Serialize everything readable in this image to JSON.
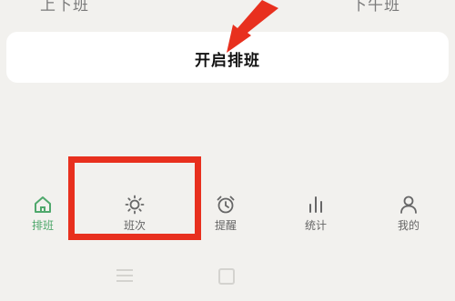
{
  "top_row": {
    "left_label": "上下班",
    "right_label": "下午班"
  },
  "card": {
    "label": "开启排班"
  },
  "tabs": [
    {
      "label": "排班",
      "icon": "home-icon",
      "active": true
    },
    {
      "label": "班次",
      "icon": "sun-icon",
      "active": false
    },
    {
      "label": "提醒",
      "icon": "alarm-clock-icon",
      "active": false
    },
    {
      "label": "统计",
      "icon": "bar-chart-icon",
      "active": false
    },
    {
      "label": "我的",
      "icon": "user-icon",
      "active": false
    }
  ],
  "colors": {
    "accent_green": "#4fa86c",
    "highlight_red": "#e8301e",
    "background": "#f2f1ee",
    "icon_gray": "#666666"
  }
}
